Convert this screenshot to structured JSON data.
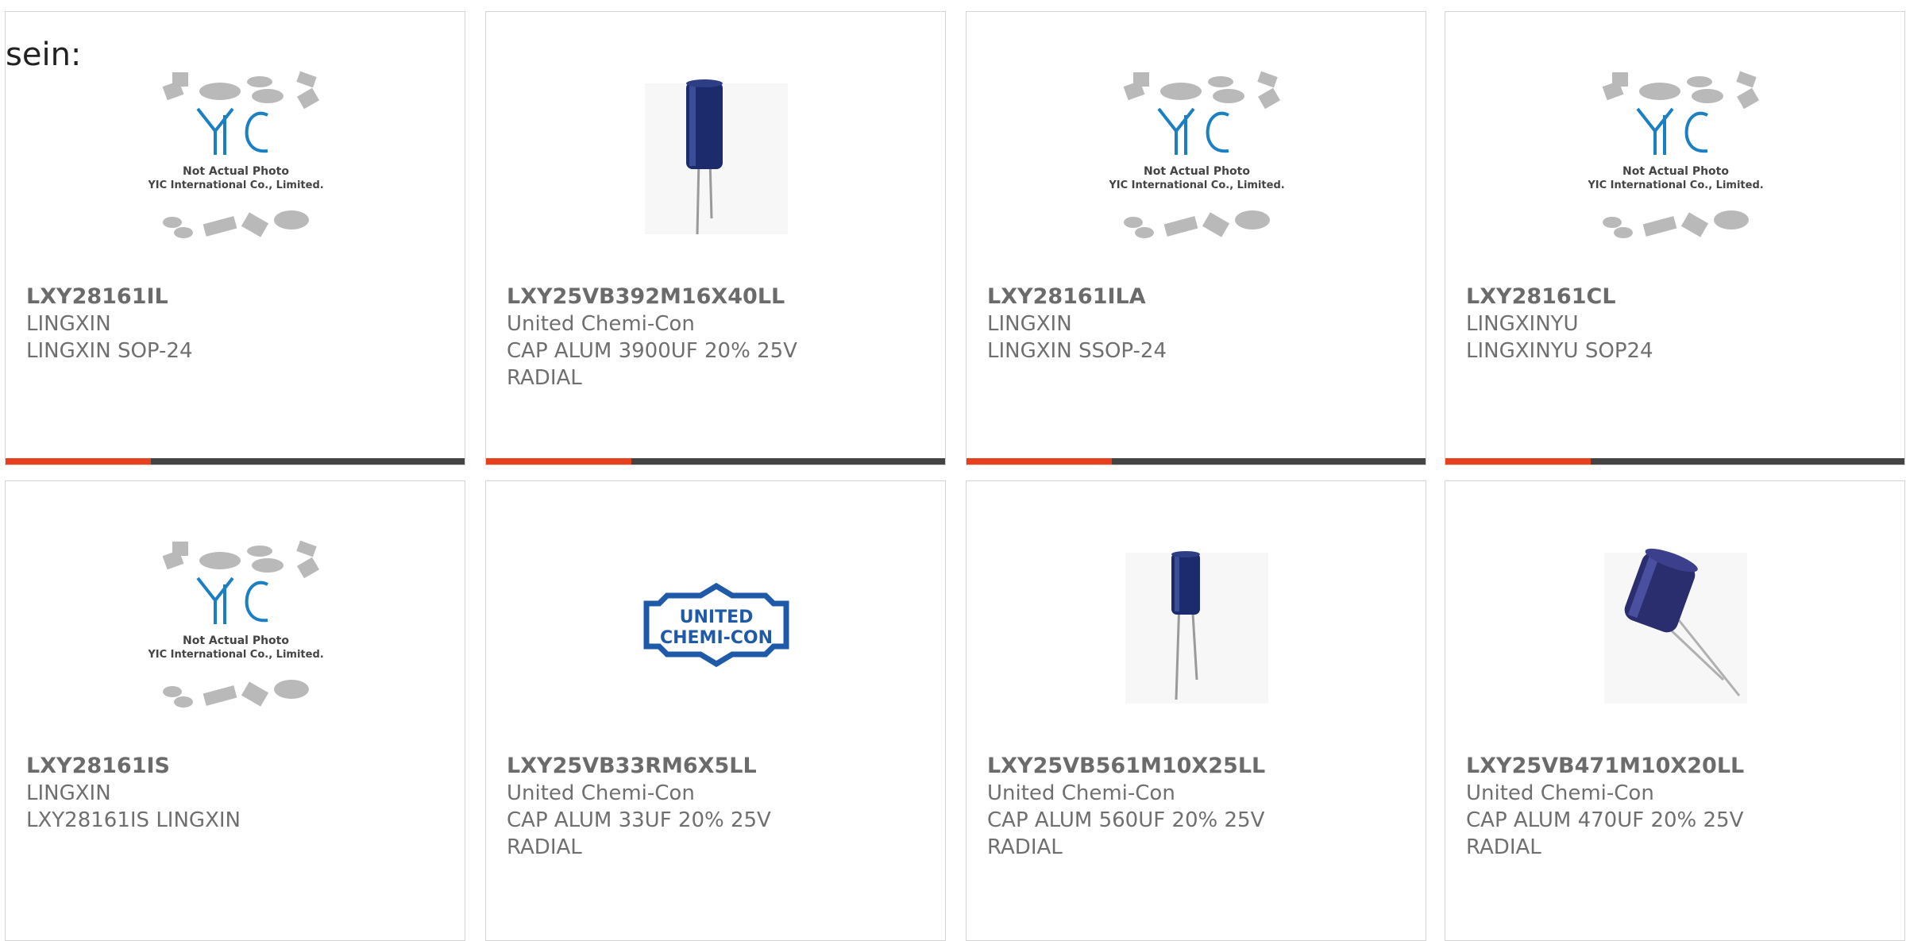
{
  "lead_text": "sein:",
  "products": [
    {
      "part": "LXY28161IL",
      "maker": "LINGXIN",
      "desc": "LINGXIN SOP-24",
      "desc2": "",
      "image": "placeholder",
      "photo_note": "Not Actual Photo",
      "company": "YIC International Co., Limited.",
      "logo_text": "YIC"
    },
    {
      "part": "LXY25VB392M16X40LL",
      "maker": "United Chemi-Con",
      "desc": "CAP ALUM 3900UF 20% 25V",
      "desc2": "RADIAL",
      "image": "tall-capacitor-icon"
    },
    {
      "part": "LXY28161ILA",
      "maker": "LINGXIN",
      "desc": "LINGXIN SSOP-24",
      "desc2": "",
      "image": "placeholder",
      "photo_note": "Not Actual Photo",
      "company": "YIC International Co., Limited.",
      "logo_text": "YIC"
    },
    {
      "part": "LXY28161CL",
      "maker": "LINGXINYU",
      "desc": "LINGXINYU SOP24",
      "desc2": "",
      "image": "placeholder",
      "photo_note": "Not Actual Photo",
      "company": "YIC International Co., Limited.",
      "logo_text": "YIC"
    },
    {
      "part": "LXY28161IS",
      "maker": "LINGXIN",
      "desc": "LXY28161IS LINGXIN",
      "desc2": "",
      "image": "placeholder",
      "photo_note": "Not Actual Photo",
      "company": "YIC International Co., Limited.",
      "logo_text": "YIC"
    },
    {
      "part": "LXY25VB33RM6X5LL",
      "maker": "United Chemi-Con",
      "desc": "CAP ALUM 33UF 20% 25V",
      "desc2": "RADIAL",
      "image": "brand-logo",
      "logo_line1": "UNITED",
      "logo_line2": "CHEMI-CON"
    },
    {
      "part": "LXY25VB561M10X25LL",
      "maker": "United Chemi-Con",
      "desc": "CAP ALUM 560UF 20% 25V",
      "desc2": "RADIAL",
      "image": "small-capacitor-icon"
    },
    {
      "part": "LXY25VB471M10X20LL",
      "maker": "United Chemi-Con",
      "desc": "CAP ALUM 470UF 20% 25V",
      "desc2": "RADIAL",
      "image": "tilted-capacitor-icon"
    }
  ],
  "colors": {
    "accent": "#e8401c",
    "bar": "#444444",
    "text": "#6b6b6b",
    "yic_blue": "#1b7fc4",
    "capacitor": "#1c2b6b",
    "logo_blue": "#1f5aa8"
  }
}
